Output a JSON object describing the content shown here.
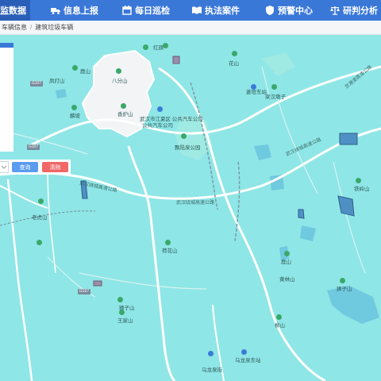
{
  "nav": {
    "items": [
      {
        "label": "监数据",
        "icon": "data-icon"
      },
      {
        "label": "信息上报",
        "icon": "truck-icon"
      },
      {
        "label": "每日巡检",
        "icon": "calendar-icon"
      },
      {
        "label": "执法案件",
        "icon": "book-icon"
      },
      {
        "label": "预警中心",
        "icon": "shield-icon"
      },
      {
        "label": "研判分析",
        "icon": "scales-icon"
      }
    ]
  },
  "breadcrumb": {
    "items": [
      "车辆信息",
      "建筑垃圾车辆"
    ]
  },
  "filter": {
    "query_label": "查询",
    "clear_label": "清除"
  },
  "map": {
    "labels": {
      "hongqi": "红旗",
      "luxiang": "鹿山",
      "bafenshan": "八分山",
      "fenghuang": "凤打山",
      "linzhou": "麟坡",
      "xiahushan": "香炉山",
      "jiangxia_bus": "武汉市江夏区\n公共汽车公司",
      "jiangxia_bus2": "公共汽车公司",
      "yuanji": "飘陆泉公园",
      "huashan": "花山",
      "changjiang": "菱垣东站",
      "jinan": "梁汉墩子",
      "laohushan": "老虎山",
      "heyuanshan": "荷花山",
      "yinshan": "狮子山",
      "wangjia": "王家山",
      "huanglin": "黄林山",
      "liushan": "柳山",
      "yulong": "鹿山",
      "wulong_station": "乌龙泉东站",
      "wulong": "乌龙泉街",
      "shizishan": "狮子山",
      "tieling": "铁岭山",
      "road1": "武汉绕城高速公路",
      "road2": "武汉绕城高速公路",
      "road3": "武汉绕城高速公路",
      "road4": "京港澳高速公路",
      "s107_1": "G107",
      "s107_2": "G107",
      "s107_3": "G107"
    }
  }
}
